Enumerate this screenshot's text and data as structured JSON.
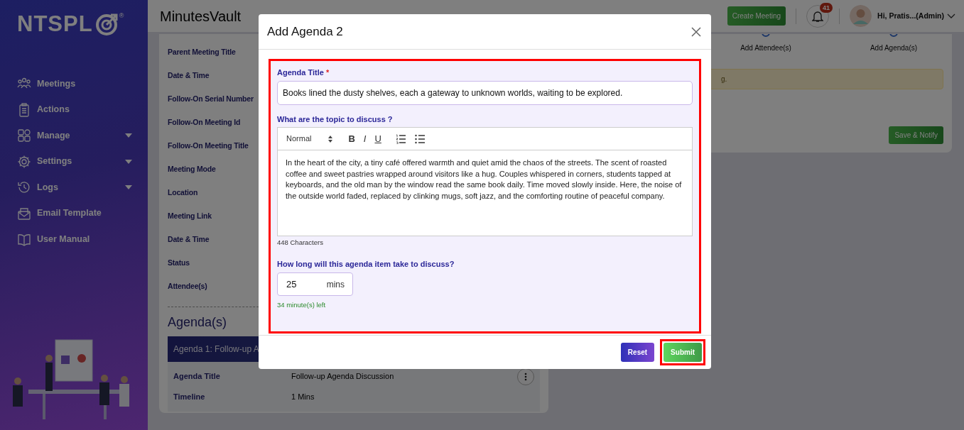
{
  "sidebar": {
    "logo": {
      "text": "NTSPL",
      "mark": "®"
    },
    "items": [
      {
        "label": "Meetings",
        "has_submenu": false
      },
      {
        "label": "Actions",
        "has_submenu": false
      },
      {
        "label": "Manage",
        "has_submenu": true
      },
      {
        "label": "Settings",
        "has_submenu": true
      },
      {
        "label": "Logs",
        "has_submenu": true
      },
      {
        "label": "Email Template",
        "has_submenu": false
      },
      {
        "label": "User Manual",
        "has_submenu": false
      }
    ]
  },
  "header": {
    "title": "MinutesVault",
    "create_button": "Create Meeting",
    "notifications": "41",
    "user": "Hi, Pratis...(Admin)"
  },
  "details": [
    {
      "label": "Parent Meeting Title"
    },
    {
      "label": "Date & Time"
    },
    {
      "label": "Follow-On Serial Number"
    },
    {
      "label": "Follow-On Meeting Id"
    },
    {
      "label": "Follow-On Meeting Title"
    },
    {
      "label": "Meeting Mode"
    },
    {
      "label": "Location"
    },
    {
      "label": "Meeting Link"
    },
    {
      "label": "Date & Time"
    },
    {
      "label": "Status"
    },
    {
      "label": "Attendee(s)"
    }
  ],
  "agendas": {
    "heading": "Agenda(s)",
    "items": [
      {
        "header": "Agenda 1: Follow-up A",
        "rows": [
          {
            "label": "Agenda Title",
            "value": "Follow-up Agenda Discussion"
          },
          {
            "label": "Timeline",
            "value": "1 Mins"
          }
        ]
      }
    ]
  },
  "steps": [
    {
      "label": "Add Attendee(s)"
    },
    {
      "label": "Add Agenda(s)"
    }
  ],
  "alert": "g.",
  "save_button": "Save & Notify",
  "modal": {
    "title": "Add Agenda 2",
    "highlighted": true,
    "agenda_title": {
      "label": "Agenda Title",
      "required": true,
      "required_mark": "*",
      "value": "Books lined the dusty shelves, each a gateway to unknown worlds, waiting to be explored."
    },
    "topic": {
      "label": "What are the topic to discuss ?",
      "format": "Normal",
      "toolbar": [
        {
          "kind": "bold",
          "text": "B"
        },
        {
          "kind": "italic",
          "text": "I"
        },
        {
          "kind": "underline",
          "text": "U"
        },
        {
          "kind": "ordered-list"
        },
        {
          "kind": "bullet-list"
        }
      ],
      "text": "In the heart of the city, a tiny café offered warmth and quiet amid the chaos of the streets. The scent of roasted coffee and sweet pastries wrapped around visitors like a hug. Couples whispered in corners, students tapped at keyboards, and the old man by the window read the same book daily. Time moved slowly inside. Here, the noise of the outside world faded, replaced by clinking mugs, soft jazz, and the comforting routine of peaceful company.",
      "count": "448 Characters"
    },
    "duration": {
      "label": "How long will this agenda item take to discuss?",
      "value": "25",
      "unit": "mins",
      "remaining": "34 minute(s) left"
    },
    "buttons": [
      {
        "kind": "reset",
        "label": "Reset",
        "highlighted": false
      },
      {
        "kind": "submit",
        "label": "Submit",
        "highlighted": true
      }
    ]
  }
}
